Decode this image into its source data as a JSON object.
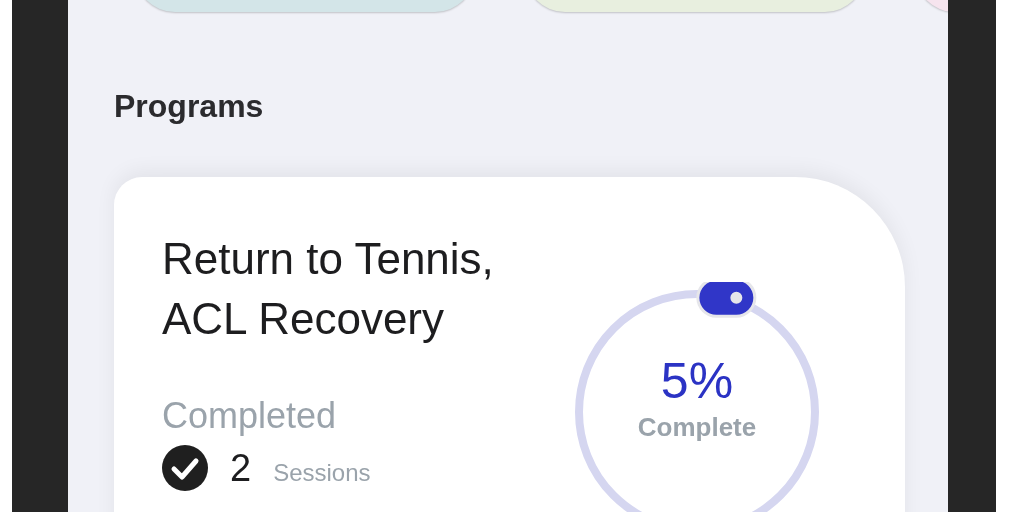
{
  "tiles": [
    {
      "color": "#d3e5e8"
    },
    {
      "color": "#e8efdf"
    },
    {
      "color": "#f6e4ee"
    }
  ],
  "section_title": "Programs",
  "program": {
    "title": "Return to Tennis, ACL Recovery",
    "progress": {
      "percent": "5%",
      "caption": "Complete"
    },
    "completed_label": "Completed",
    "sessions": {
      "count": "2",
      "unit": "Sessions"
    }
  }
}
